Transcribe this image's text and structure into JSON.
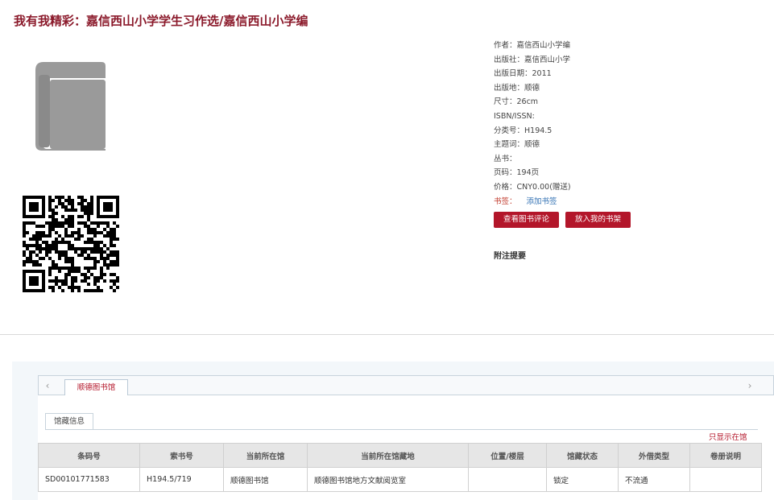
{
  "page": {
    "title": "我有我精彩：嘉信西山小学学生习作选/嘉信西山小学编"
  },
  "icons": {
    "cover": "book-icon",
    "qr": "qr-code-icon",
    "left": "chevron-left-icon",
    "right": "chevron-right-icon"
  },
  "meta": {
    "author": "作者：嘉信西山小学编",
    "publisher": "出版社：嘉信西山小学",
    "pub_date": "出版日期：2011",
    "pub_place": "出版地：顺德",
    "size": "尺寸：26cm",
    "isbn": "ISBN/ISSN:",
    "class_no": "分类号：H194.5",
    "subject": "主题词：顺德",
    "series": "丛书：",
    "pages": "页码：194页",
    "price": "价格：CNY0.00(赠送)",
    "bookmark_label": "书签：",
    "bookmark_link": "添加书签"
  },
  "buttons": {
    "review": "查看图书评论",
    "shelf": "放入我的书架"
  },
  "notes": {
    "title": "附注提要"
  },
  "holdings": {
    "library_tab": "顺德图书馆",
    "sub_tab": "馆藏信息",
    "only_this": "只显示在馆",
    "columns": [
      "条码号",
      "索书号",
      "当前所在馆",
      "当前所在馆藏地",
      "位置/楼层",
      "馆藏状态",
      "外借类型",
      "卷册说明"
    ],
    "rows": [
      [
        "SD00101771583",
        "H194.5/719",
        "顺德图书馆",
        "顺德图书馆地方文献阅览室",
        "",
        "锁定",
        "不流通",
        ""
      ]
    ]
  },
  "colors": {
    "accent": "#b3162a",
    "title": "#8b1a2b",
    "link": "#2f6fb2"
  }
}
